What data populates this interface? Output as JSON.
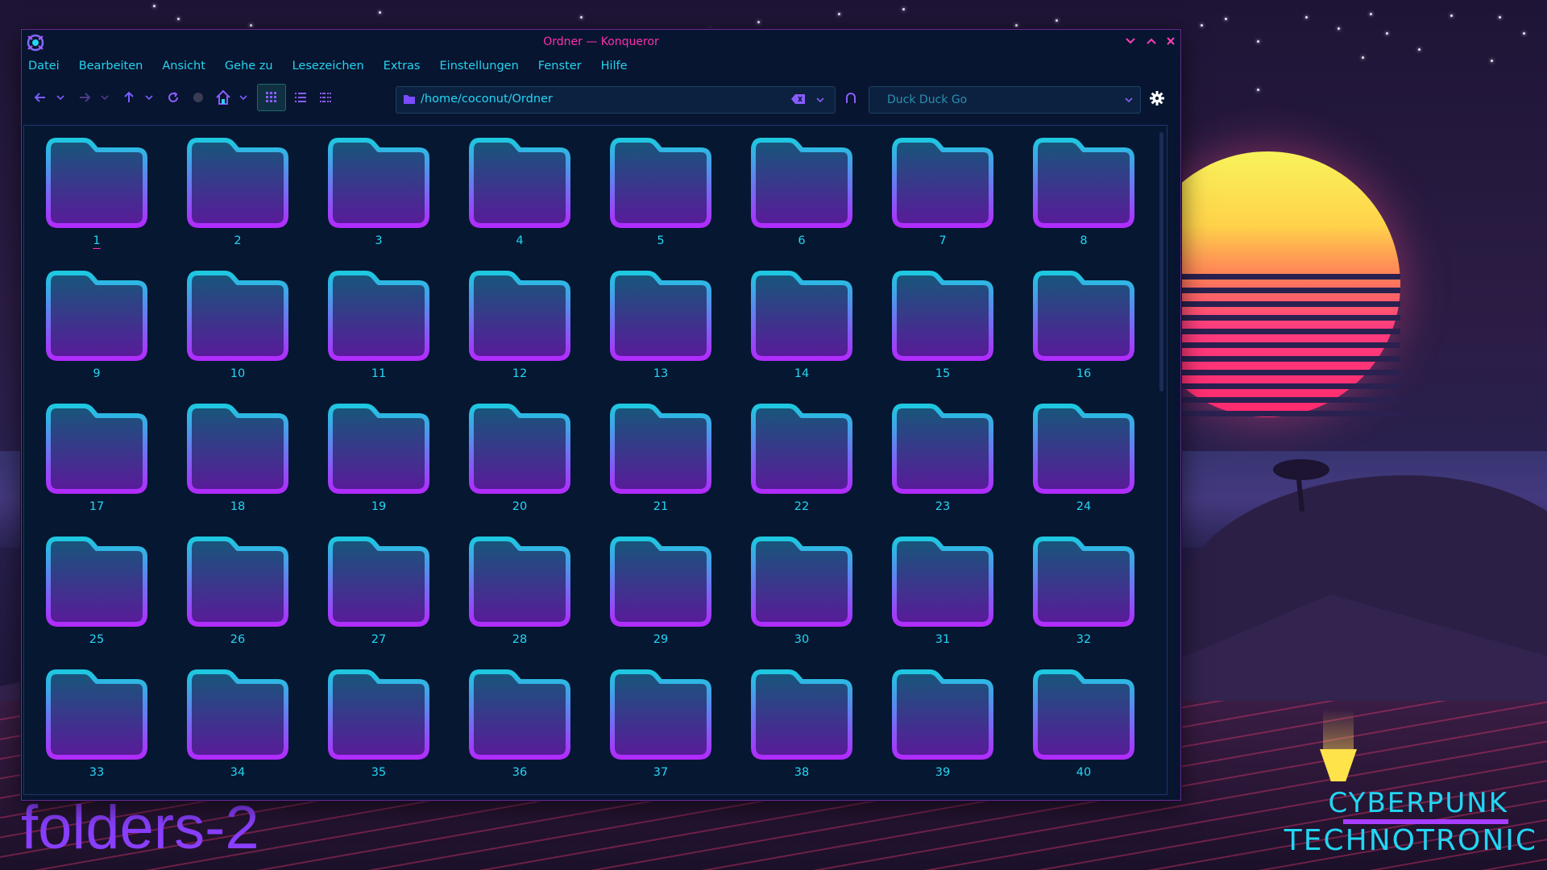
{
  "window": {
    "title": "Ordner — Konqueror"
  },
  "menu": [
    "Datei",
    "Bearbeiten",
    "Ansicht",
    "Gehe zu",
    "Lesezeichen",
    "Extras",
    "Einstellungen",
    "Fenster",
    "Hilfe"
  ],
  "toolbar": {
    "location": "/home/coconut/Ordner",
    "search_engine": "Duck Duck Go"
  },
  "folders": [
    "1",
    "2",
    "3",
    "4",
    "5",
    "6",
    "7",
    "8",
    "9",
    "10",
    "11",
    "12",
    "13",
    "14",
    "15",
    "16",
    "17",
    "18",
    "19",
    "20",
    "21",
    "22",
    "23",
    "24",
    "25",
    "26",
    "27",
    "28",
    "29",
    "30",
    "31",
    "32",
    "33",
    "34",
    "35",
    "36",
    "37",
    "38",
    "39",
    "40"
  ],
  "wallpaper": {
    "caption": "folders-2",
    "brand_line1": "CYBERPUNK",
    "brand_line2": "TECHNOTRONIC"
  },
  "colors": {
    "accent_cyan": "#23d6f2",
    "accent_pink": "#ff2fb0",
    "window_bg": "#071530",
    "folder_top": "#1ec8e0",
    "folder_bottom": "#b12cff"
  },
  "icons": {
    "back": "arrow-left-icon",
    "forward": "arrow-right-icon",
    "up": "arrow-up-icon",
    "reload": "reload-icon",
    "stop": "stop-icon",
    "home": "home-icon",
    "icon_view": "icon-view-icon",
    "details_view": "details-view-icon",
    "compact_view": "compact-view-icon",
    "clear": "clear-text-icon",
    "go": "go-icon",
    "settings": "gear-icon"
  }
}
